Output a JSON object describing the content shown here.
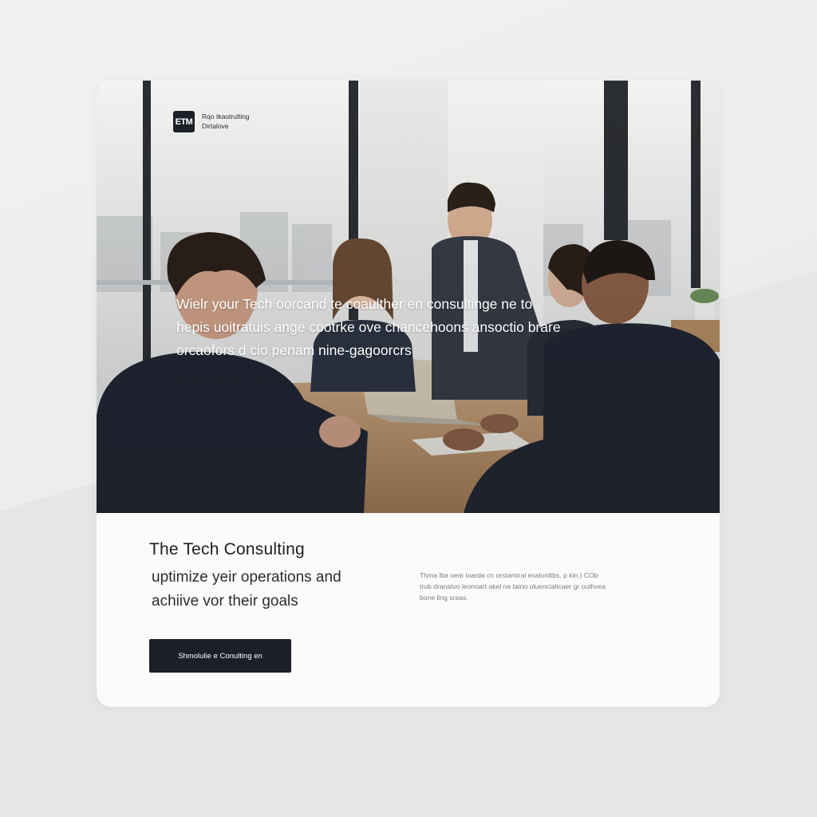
{
  "brand": {
    "mark": "ETM",
    "line1": "Rqo tkaotrulting",
    "line2": "Dirtalove"
  },
  "hero": {
    "lines": [
      "Wielr your Tech oorcand te coaulther en consultinge ne to",
      "hepis uoitratuis ange cootrke ove chancehoons ansoctio brare",
      "orcaofors d cio penam nine-gagoorcrs"
    ]
  },
  "content": {
    "headline": "The Tech Consulting",
    "tagline": [
      "uptimize yeir operations and",
      "achiive vor their goals"
    ],
    "description": [
      "Thma lba oear loarda cn orstamiral exalordtbs. p kin.) COb",
      "trub dranatvo leonoart akel na taino oluencialicaer gr outhvea",
      "bone ling sraas."
    ],
    "cta_label": "Shmolulie e Conulting en"
  },
  "colors": {
    "accent": "#1b1f27",
    "card_background": "#fbfbfa",
    "page_background": "#ececeb"
  }
}
